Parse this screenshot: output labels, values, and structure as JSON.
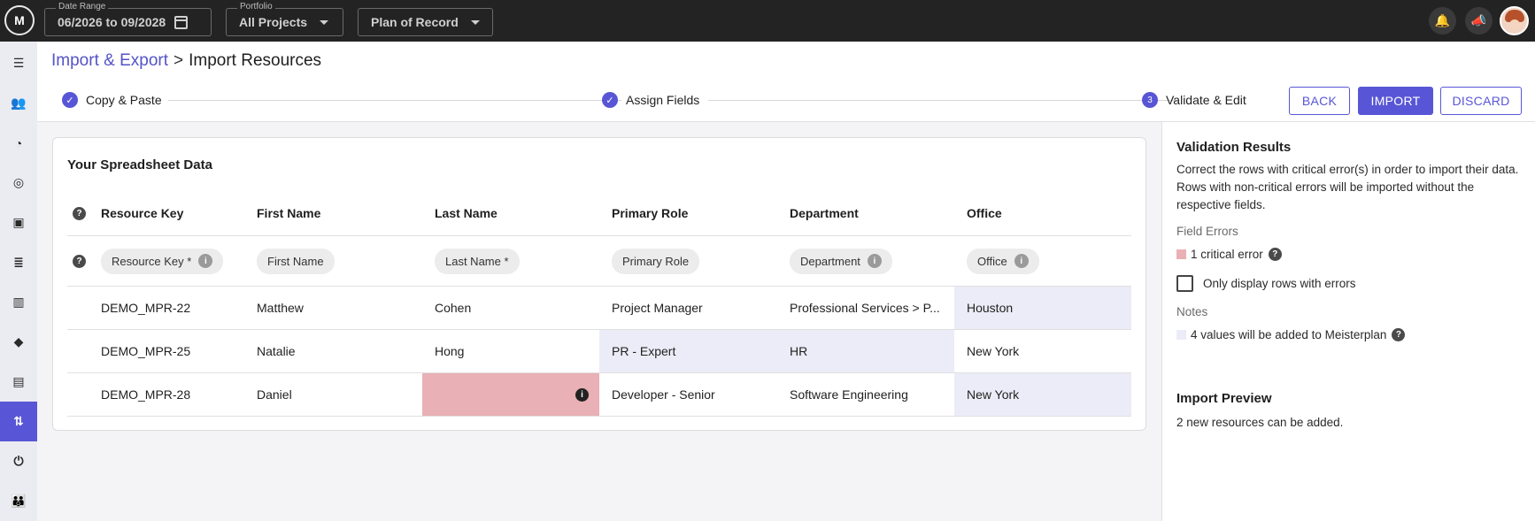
{
  "topbar": {
    "logo": "M",
    "date_range": {
      "label": "Date Range",
      "value": "06/2026 to 09/2028"
    },
    "portfolio": {
      "label": "Portfolio",
      "value": "All Projects"
    },
    "plan": {
      "value": "Plan of Record"
    }
  },
  "breadcrumb": {
    "parent": "Import & Export",
    "separator": ">",
    "current": "Import Resources"
  },
  "steps": [
    {
      "label": "Copy & Paste",
      "check": "✓"
    },
    {
      "label": "Assign Fields",
      "check": "✓"
    },
    {
      "label": "Validate & Edit",
      "number": "3"
    }
  ],
  "actions": {
    "back": "BACK",
    "import": "IMPORT",
    "discard": "DISCARD"
  },
  "card": {
    "title": "Your Spreadsheet Data"
  },
  "table": {
    "help": "?",
    "headers": [
      "Resource Key",
      "First Name",
      "Last Name",
      "Primary Role",
      "Department",
      "Office"
    ],
    "mappings": [
      {
        "label": "Resource Key *",
        "info": "i"
      },
      {
        "label": "First Name"
      },
      {
        "label": "Last Name *"
      },
      {
        "label": "Primary Role"
      },
      {
        "label": "Department",
        "info": "i"
      },
      {
        "label": "Office",
        "info": "i"
      }
    ],
    "rows": [
      {
        "key": "DEMO_MPR-22",
        "first": "Matthew",
        "last": "Cohen",
        "role": "Project Manager",
        "dept": "Professional Services > P...",
        "office": "Houston"
      },
      {
        "key": "DEMO_MPR-25",
        "first": "Natalie",
        "last": "Hong",
        "role": "PR - Expert",
        "dept": "HR",
        "office": "New York"
      },
      {
        "key": "DEMO_MPR-28",
        "first": "Daniel",
        "last": "",
        "role": "Developer - Senior",
        "dept": "Software Engineering",
        "office": "New York"
      }
    ],
    "error_info": "i"
  },
  "validation": {
    "title": "Validation Results",
    "description": "Correct the rows with critical error(s) in order to import their data. Rows with non-critical errors will be imported without the respective fields.",
    "field_errors_label": "Field Errors",
    "critical_error": "1 critical error",
    "only_errors_label": "Only display rows with errors",
    "notes_label": "Notes",
    "added_note": "4 values will be added to Meisterplan",
    "help": "?"
  },
  "preview": {
    "title": "Import Preview",
    "text": "2 new resources can be added."
  },
  "colors": {
    "accent": "#5856d6",
    "critical": "#e9b0b5",
    "added": "#ececf8"
  },
  "icons": {
    "bell": "🔔",
    "megaphone": "📣",
    "sidebar": [
      "☰",
      "👥",
      "◔",
      "◎",
      "▣",
      "≣",
      "▥",
      "◆",
      "▤",
      "⇅",
      "⏻",
      "👪"
    ]
  }
}
